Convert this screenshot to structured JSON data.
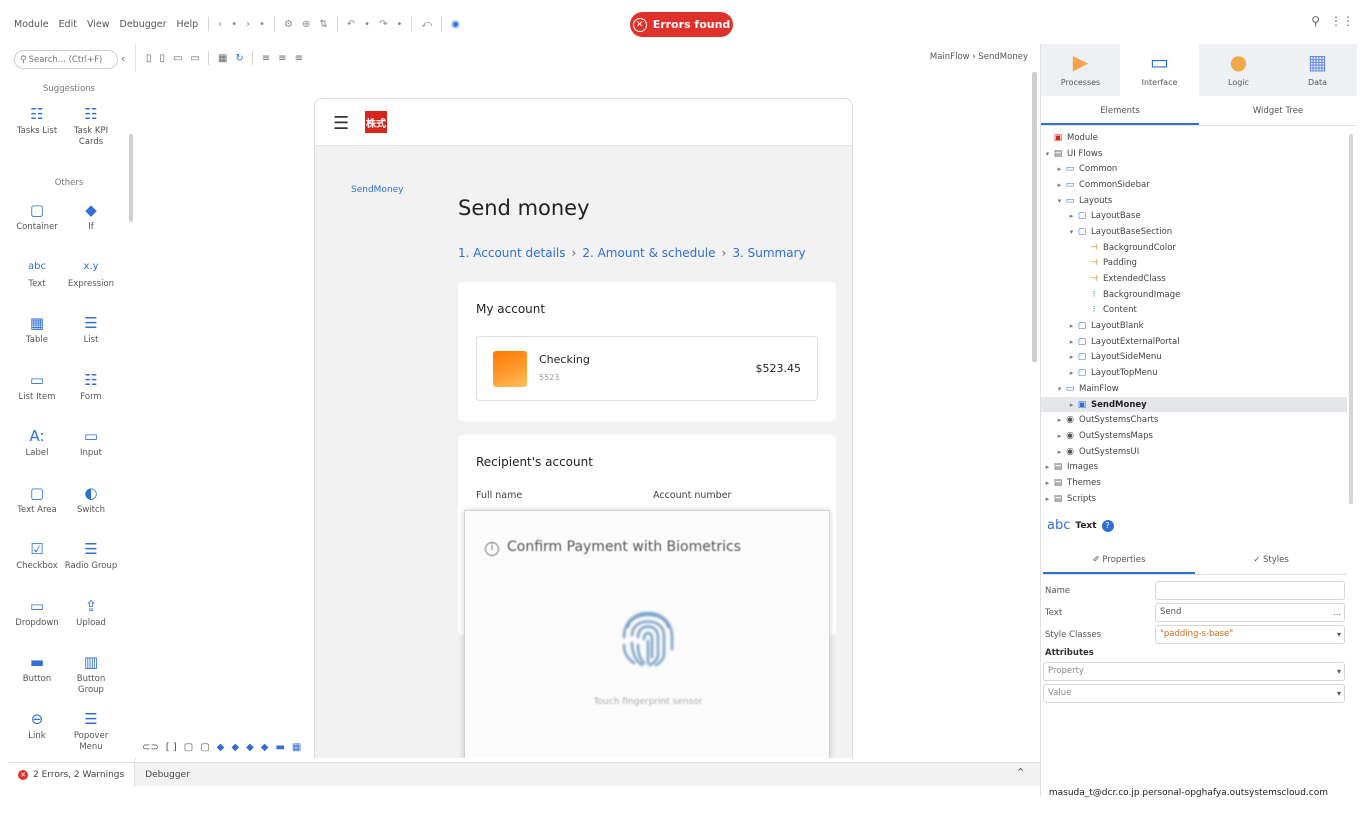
{
  "menu": [
    "Module",
    "Edit",
    "View",
    "Debugger",
    "Help"
  ],
  "toolbar_glyphs": [
    "‹",
    "•",
    "›",
    "•",
    "⚙",
    "⊕",
    "⇅",
    "↶",
    "•",
    "↷",
    "•",
    "⤺",
    "◉"
  ],
  "error_pill": "Errors found",
  "toolbox": {
    "search_placeholder": "Search... (Ctrl+F)",
    "suggestions_title": "Suggestions",
    "others_title": "Others",
    "suggestions": [
      {
        "icon": "☷",
        "label": "Tasks List"
      },
      {
        "icon": "☷",
        "label": "Task KPI Cards"
      }
    ],
    "tools": [
      {
        "icon": "▢",
        "label": "Container"
      },
      {
        "icon": "◆",
        "label": "If"
      },
      {
        "icon": "abc",
        "label": "Text"
      },
      {
        "icon": "x.y",
        "label": "Expression"
      },
      {
        "icon": "▦",
        "label": "Table"
      },
      {
        "icon": "☰",
        "label": "List"
      },
      {
        "icon": "▭",
        "label": "List Item"
      },
      {
        "icon": "☷",
        "label": "Form"
      },
      {
        "icon": "A:",
        "label": "Label"
      },
      {
        "icon": "▭",
        "label": "Input"
      },
      {
        "icon": "▢",
        "label": "Text Area"
      },
      {
        "icon": "◐",
        "label": "Switch"
      },
      {
        "icon": "☑",
        "label": "Checkbox"
      },
      {
        "icon": "☰",
        "label": "Radio Group"
      },
      {
        "icon": "▭",
        "label": "Dropdown"
      },
      {
        "icon": "⇪",
        "label": "Upload"
      },
      {
        "icon": "▬",
        "label": "Button"
      },
      {
        "icon": "▥",
        "label": "Button Group"
      },
      {
        "icon": "⊖",
        "label": "Link"
      },
      {
        "icon": "☰",
        "label": "Popover Menu"
      }
    ]
  },
  "canvas_toolbar": [
    "▯",
    "▯",
    "▭",
    "▭",
    "▦",
    "↻",
    "≡",
    "≡",
    "≡"
  ],
  "breadcrumb": "MainFlow › SendMoney",
  "app": {
    "logo": "株式",
    "side_link": "SendMoney",
    "title": "Send money",
    "steps": [
      "1. Account details",
      "2. Amount & schedule",
      "3. Summary"
    ],
    "step_sep": "›",
    "my_account": {
      "title": "My account",
      "name": "Checking",
      "number": "5523",
      "balance": "$523.45"
    },
    "recipient": {
      "title": "Recipient's account",
      "full_name_label": "Full name",
      "account_number_label": "Account number"
    },
    "biometrics": {
      "title": "Confirm Payment with Biometrics",
      "hint": "Touch fingerprint sensor"
    }
  },
  "layer_tabs": [
    {
      "label": "Processes",
      "icon": "▶",
      "color": "#f5a24b"
    },
    {
      "label": "Interface",
      "icon": "▭",
      "color": "#2f6fd6"
    },
    {
      "label": "Logic",
      "icon": "●",
      "color": "#f0a848"
    },
    {
      "label": "Data",
      "icon": "▦",
      "color": "#6c8ee0"
    }
  ],
  "subtabs": [
    "Elements",
    "Widget Tree"
  ],
  "tree": [
    {
      "label": "Module",
      "depth": 0,
      "arrow": "",
      "icon": "▣",
      "color": "#d9261c"
    },
    {
      "label": "UI Flows",
      "depth": 0,
      "arrow": "▾",
      "icon": "▤",
      "color": "#666"
    },
    {
      "label": "Common",
      "depth": 1,
      "arrow": "▸",
      "icon": "▭",
      "color": "#2f6fd6"
    },
    {
      "label": "CommonSidebar",
      "depth": 1,
      "arrow": "▸",
      "icon": "▭",
      "color": "#2f6fd6"
    },
    {
      "label": "Layouts",
      "depth": 1,
      "arrow": "▾",
      "icon": "▭",
      "color": "#2f6fd6"
    },
    {
      "label": "LayoutBase",
      "depth": 2,
      "arrow": "▸",
      "icon": "▢",
      "color": "#2f6fd6"
    },
    {
      "label": "LayoutBaseSection",
      "depth": 2,
      "arrow": "▾",
      "icon": "▢",
      "color": "#2f6fd6"
    },
    {
      "label": "BackgroundColor",
      "depth": 3,
      "arrow": "",
      "icon": "⊣",
      "color": "#e07b00"
    },
    {
      "label": "Padding",
      "depth": 3,
      "arrow": "",
      "icon": "⊣",
      "color": "#e07b00"
    },
    {
      "label": "ExtendedClass",
      "depth": 3,
      "arrow": "",
      "icon": "⊣",
      "color": "#e07b00"
    },
    {
      "label": "BackgroundImage",
      "depth": 3,
      "arrow": "",
      "icon": "⁝",
      "color": "#2f6fd6"
    },
    {
      "label": "Content",
      "depth": 3,
      "arrow": "",
      "icon": "⁝",
      "color": "#2f6fd6"
    },
    {
      "label": "LayoutBlank",
      "depth": 2,
      "arrow": "▸",
      "icon": "▢",
      "color": "#2f6fd6"
    },
    {
      "label": "LayoutExternalPortal",
      "depth": 2,
      "arrow": "▸",
      "icon": "▢",
      "color": "#2f6fd6"
    },
    {
      "label": "LayoutSideMenu",
      "depth": 2,
      "arrow": "▸",
      "icon": "▢",
      "color": "#2f6fd6"
    },
    {
      "label": "LayoutTopMenu",
      "depth": 2,
      "arrow": "▸",
      "icon": "▢",
      "color": "#2f6fd6"
    },
    {
      "label": "MainFlow",
      "depth": 1,
      "arrow": "▾",
      "icon": "▭",
      "color": "#2f6fd6"
    },
    {
      "label": "SendMoney",
      "depth": 2,
      "arrow": "▸",
      "icon": "▣",
      "color": "#2f6fd6",
      "selected": true
    },
    {
      "label": "OutSystemsCharts",
      "depth": 1,
      "arrow": "▸",
      "icon": "◉",
      "color": "#555"
    },
    {
      "label": "OutSystemsMaps",
      "depth": 1,
      "arrow": "▸",
      "icon": "◉",
      "color": "#555"
    },
    {
      "label": "OutSystemsUI",
      "depth": 1,
      "arrow": "▸",
      "icon": "◉",
      "color": "#555"
    },
    {
      "label": "Images",
      "depth": 0,
      "arrow": "▸",
      "icon": "▤",
      "color": "#666"
    },
    {
      "label": "Themes",
      "depth": 0,
      "arrow": "▸",
      "icon": "▤",
      "color": "#666"
    },
    {
      "label": "Scripts",
      "depth": 0,
      "arrow": "▸",
      "icon": "▤",
      "color": "#666"
    }
  ],
  "props": {
    "widget_icon": "abc",
    "widget_type": "Text",
    "help": "?",
    "tab_properties": "✐ Properties",
    "tab_styles": "✓ Styles",
    "name_label": "Name",
    "name_value": "",
    "text_label": "Text",
    "text_value": "Send",
    "text_more": "...",
    "style_label": "Style Classes",
    "style_value": "\"padding-s-base\"",
    "attributes_title": "Attributes",
    "property_placeholder": "Property",
    "value_placeholder": "Value"
  },
  "bottom": {
    "errors_tab": "2 Errors, 2 Warnings",
    "debugger_tab": "Debugger",
    "user_info": "masuda_t@dcr.co.jp personal-opghafya.outsystemscloud.com"
  }
}
